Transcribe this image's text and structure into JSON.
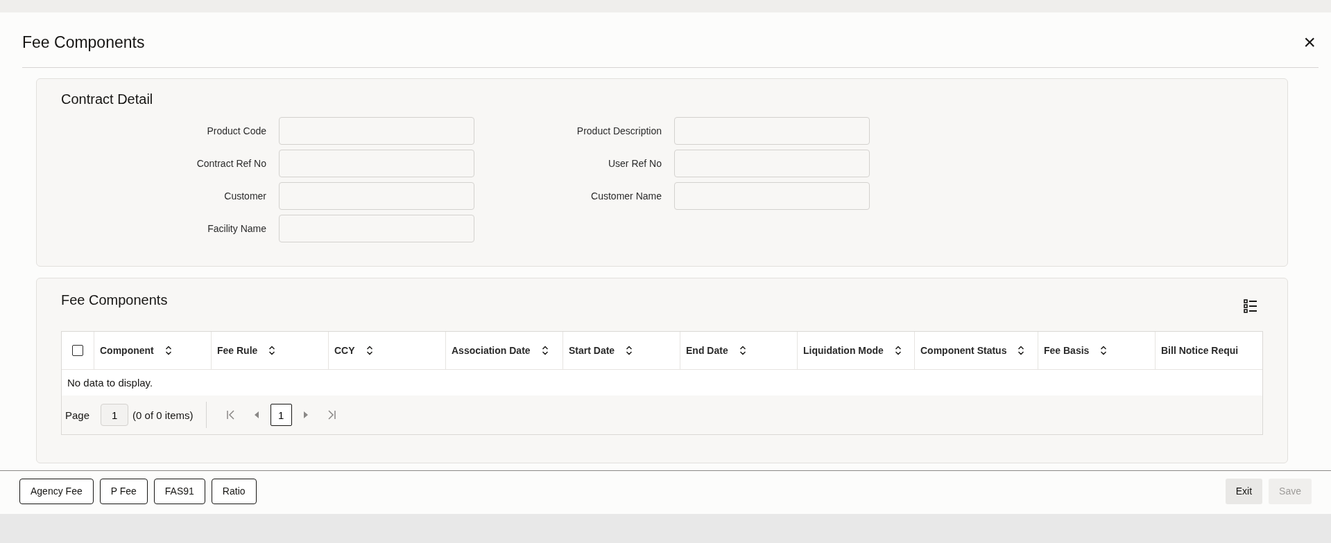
{
  "window": {
    "title": "Fee Components",
    "close": "×"
  },
  "contract_detail": {
    "title": "Contract Detail",
    "fields": [
      {
        "label": "Product Code"
      },
      {
        "label": "Product Description"
      },
      {
        "label": "Contract Ref No"
      },
      {
        "label": "User Ref No"
      },
      {
        "label": "Customer"
      },
      {
        "label": "Customer Name"
      },
      {
        "label": "Facility Name"
      }
    ]
  },
  "fee_components": {
    "title": "Fee Components",
    "table": {
      "select_all": {
        "checked": false
      },
      "columns": [
        "Component",
        "Fee Rule",
        "CCY",
        "Association Date",
        "Start Date",
        "End Date",
        "Liquidation Mode",
        "Component Status",
        "Fee Basis",
        "Bill Notice Requi"
      ],
      "empty_message": "No data to display."
    },
    "pagination": {
      "label": "Page",
      "page": "1",
      "summary": "(0 of 0 items)",
      "current": "1"
    }
  },
  "footer": {
    "left_buttons": [
      {
        "label": "Agency Fee",
        "disabled": false
      },
      {
        "label": "P Fee",
        "disabled": false
      },
      {
        "label": "FAS91",
        "disabled": false
      },
      {
        "label": "Ratio",
        "disabled": false
      }
    ],
    "right_buttons": [
      {
        "label": "Exit",
        "disabled": false
      },
      {
        "label": "Save",
        "disabled": true
      }
    ]
  }
}
